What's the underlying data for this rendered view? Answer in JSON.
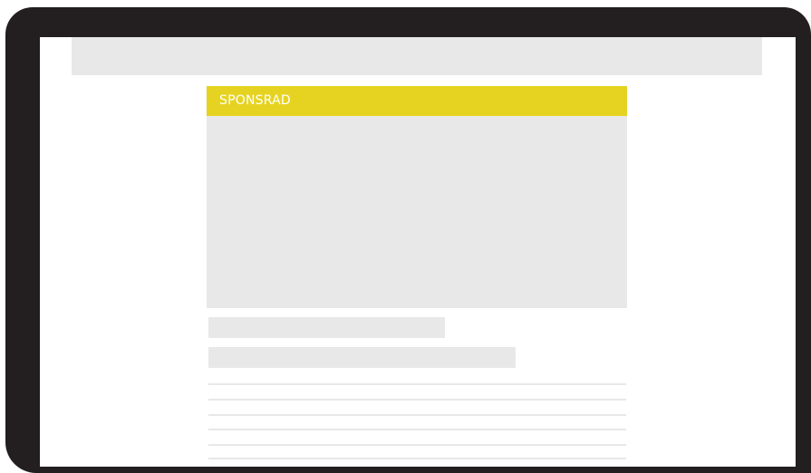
{
  "ad": {
    "sponsored_label": "SPONSRAD"
  },
  "colors": {
    "frame": "#231f20",
    "placeholder": "#e8e8e8",
    "sponsored_accent": "#e6d321",
    "screen": "#ffffff"
  },
  "placeholders": {
    "headline_lines": 2,
    "body_lines": 6
  }
}
